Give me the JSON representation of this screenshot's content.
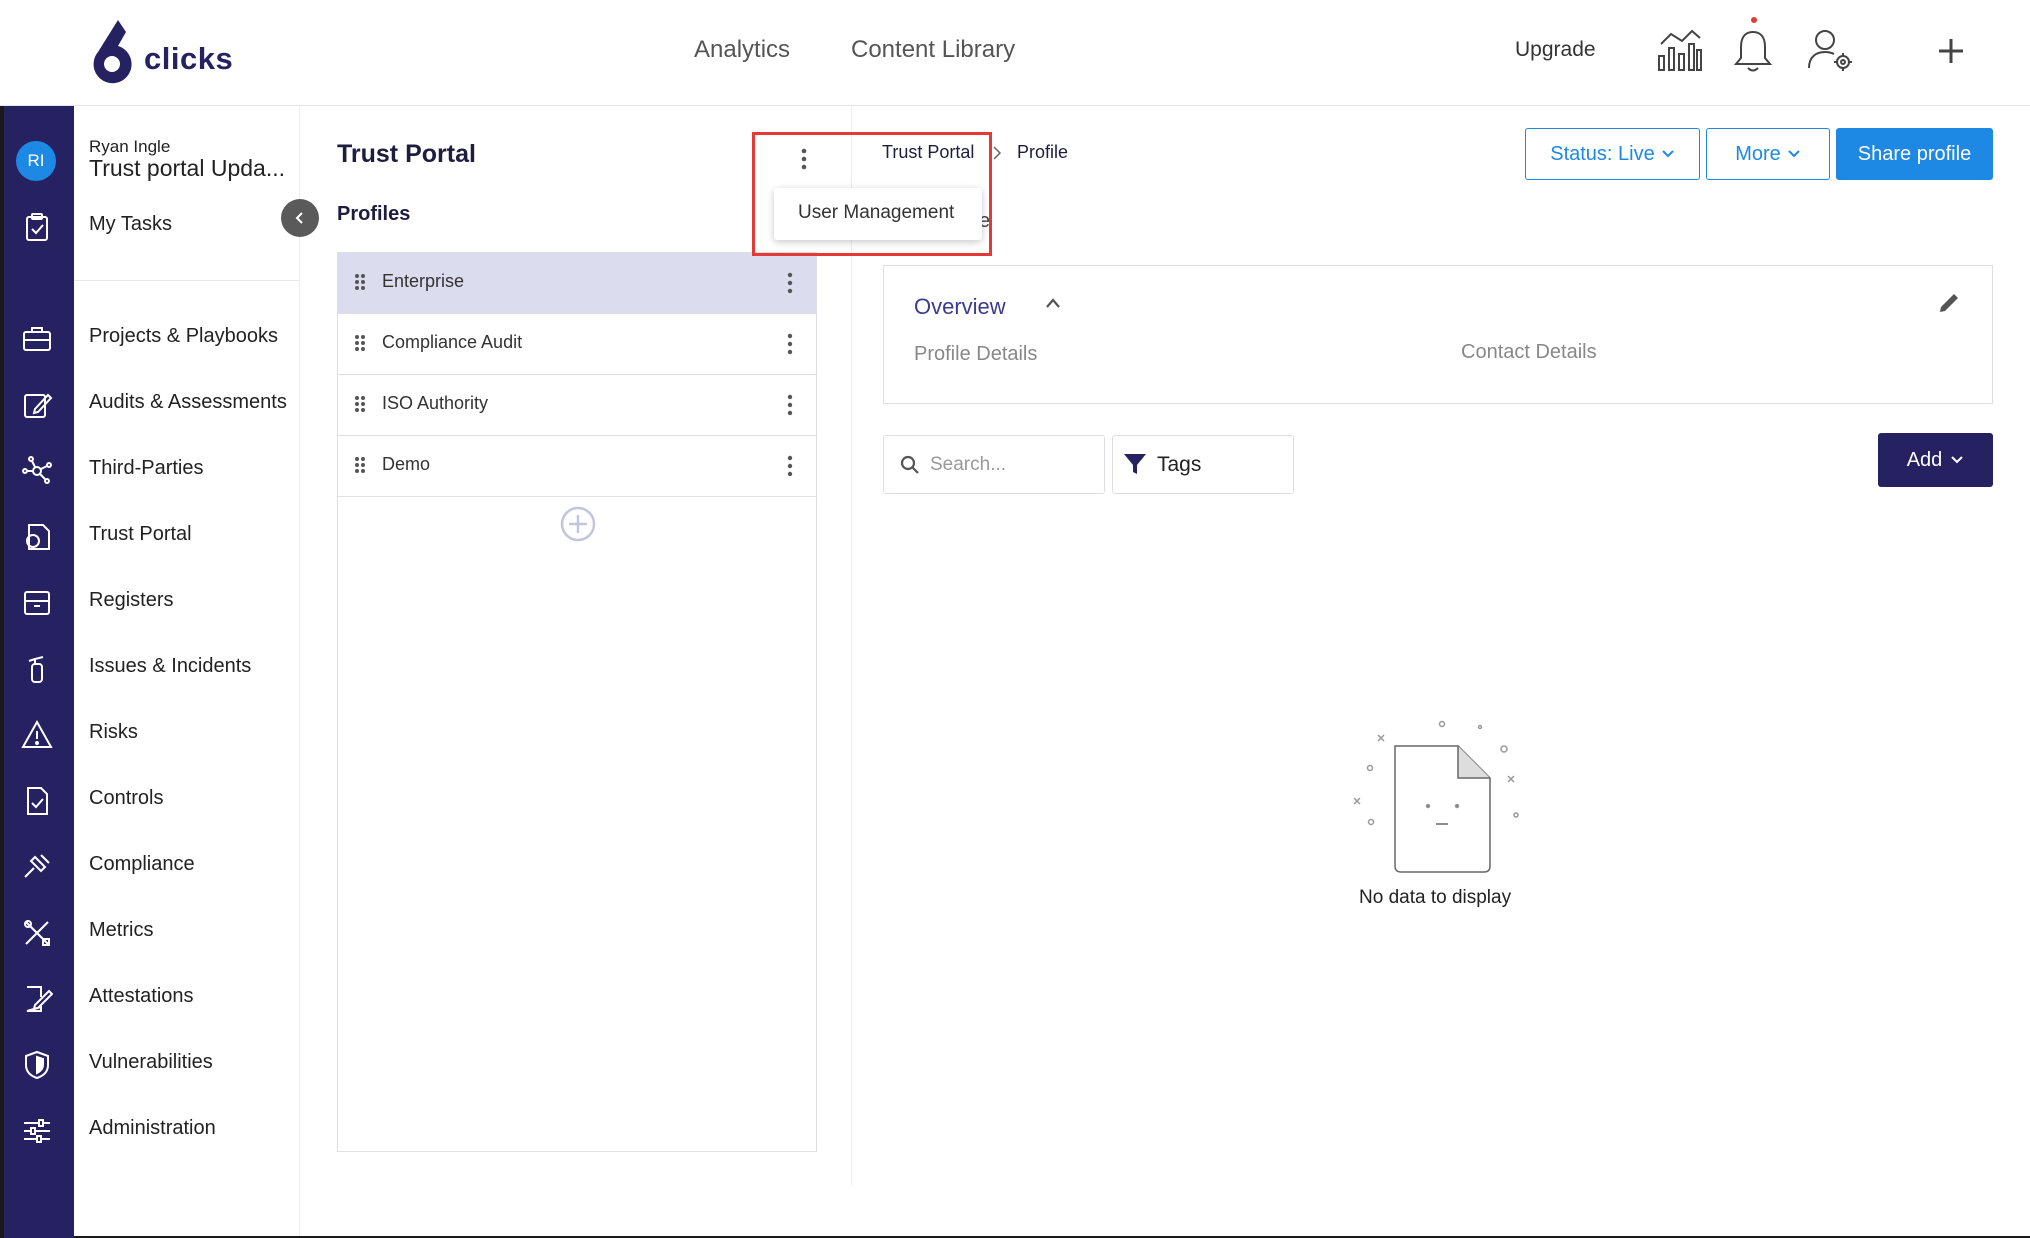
{
  "brand": {
    "name": "clicks",
    "color": "#262262",
    "accent": "#1e88e5"
  },
  "topnav": {
    "analytics": "Analytics",
    "content_library": "Content Library",
    "upgrade": "Upgrade"
  },
  "top_icons": [
    "chart-icon",
    "bell-icon",
    "user-settings-icon",
    "plus-icon"
  ],
  "user": {
    "initials": "RI",
    "name": "Ryan Ingle",
    "org": "Trust portal Upda..."
  },
  "sidebar": {
    "my_tasks": "My Tasks",
    "items": [
      {
        "label": "Projects & Playbooks",
        "icon": "briefcase-icon"
      },
      {
        "label": "Audits & Assessments",
        "icon": "edit-square-icon"
      },
      {
        "label": "Third-Parties",
        "icon": "network-icon"
      },
      {
        "label": "Trust Portal",
        "icon": "portal-document-icon"
      },
      {
        "label": "Registers",
        "icon": "register-box-icon"
      },
      {
        "label": "Issues & Incidents",
        "icon": "fire-extinguisher-icon"
      },
      {
        "label": "Risks",
        "icon": "warning-icon"
      },
      {
        "label": "Controls",
        "icon": "checklist-icon"
      },
      {
        "label": "Compliance",
        "icon": "gavel-icon"
      },
      {
        "label": "Metrics",
        "icon": "tools-icon"
      },
      {
        "label": "Attestations",
        "icon": "signature-icon"
      },
      {
        "label": "Vulnerabilities",
        "icon": "shield-icon"
      },
      {
        "label": "Administration",
        "icon": "sliders-icon"
      }
    ]
  },
  "panel": {
    "title": "Trust Portal",
    "profiles_label": "Profiles",
    "profiles": [
      {
        "label": "Enterprise",
        "selected": true
      },
      {
        "label": "Compliance Audit",
        "selected": false
      },
      {
        "label": "ISO Authority",
        "selected": false
      },
      {
        "label": "Demo",
        "selected": false
      }
    ]
  },
  "dropdown": {
    "item": "User Management",
    "highlight_color": "#e53935"
  },
  "breadcrumb": {
    "root": "Trust Portal",
    "current": "Profile",
    "peek": "e"
  },
  "actions": {
    "status_prefix": "Status: ",
    "status_value": "Live",
    "more": "More",
    "share": "Share profile"
  },
  "overview": {
    "title": "Overview",
    "tab_profile": "Profile Details",
    "tab_contact": "Contact Details"
  },
  "toolbar": {
    "search_placeholder": "Search...",
    "tags": "Tags",
    "add": "Add"
  },
  "empty_state": {
    "text": "No data to display"
  }
}
